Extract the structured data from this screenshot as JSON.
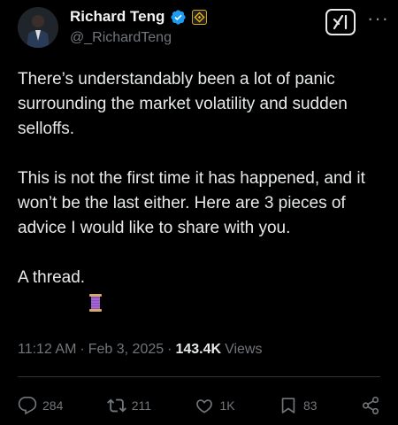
{
  "author": {
    "display_name": "Richard Teng",
    "handle": "@_RichardTeng",
    "verified_icon": "verified-badge-icon",
    "affiliate_icon": "binance-affiliate-icon"
  },
  "header_actions": {
    "grok_icon": "grok-icon",
    "more_icon": "more-icon",
    "more_label": "···"
  },
  "post": {
    "paragraphs": [
      "There’s understandably been a lot of panic surrounding the market volatility and sudden selloffs.",
      "This is not the first time it has happened, and it won’t be the last either. Here are 3 pieces of advice I would like to share with you."
    ],
    "thread_text": "A thread.",
    "thread_emoji_icon": "thread-spool-icon"
  },
  "meta": {
    "time": "11:12 AM",
    "sep1": "·",
    "date": "Feb 3, 2025",
    "sep2": "·",
    "views_count": "143.4K",
    "views_label": "Views"
  },
  "actions": {
    "replies": "284",
    "reposts": "211",
    "likes": "1K",
    "bookmarks": "83"
  },
  "colors": {
    "background": "#000000",
    "text": "#e7e9ea",
    "muted": "#71767b",
    "verified_blue": "#1d9bf0",
    "binance_yellow": "#f0b90b"
  }
}
